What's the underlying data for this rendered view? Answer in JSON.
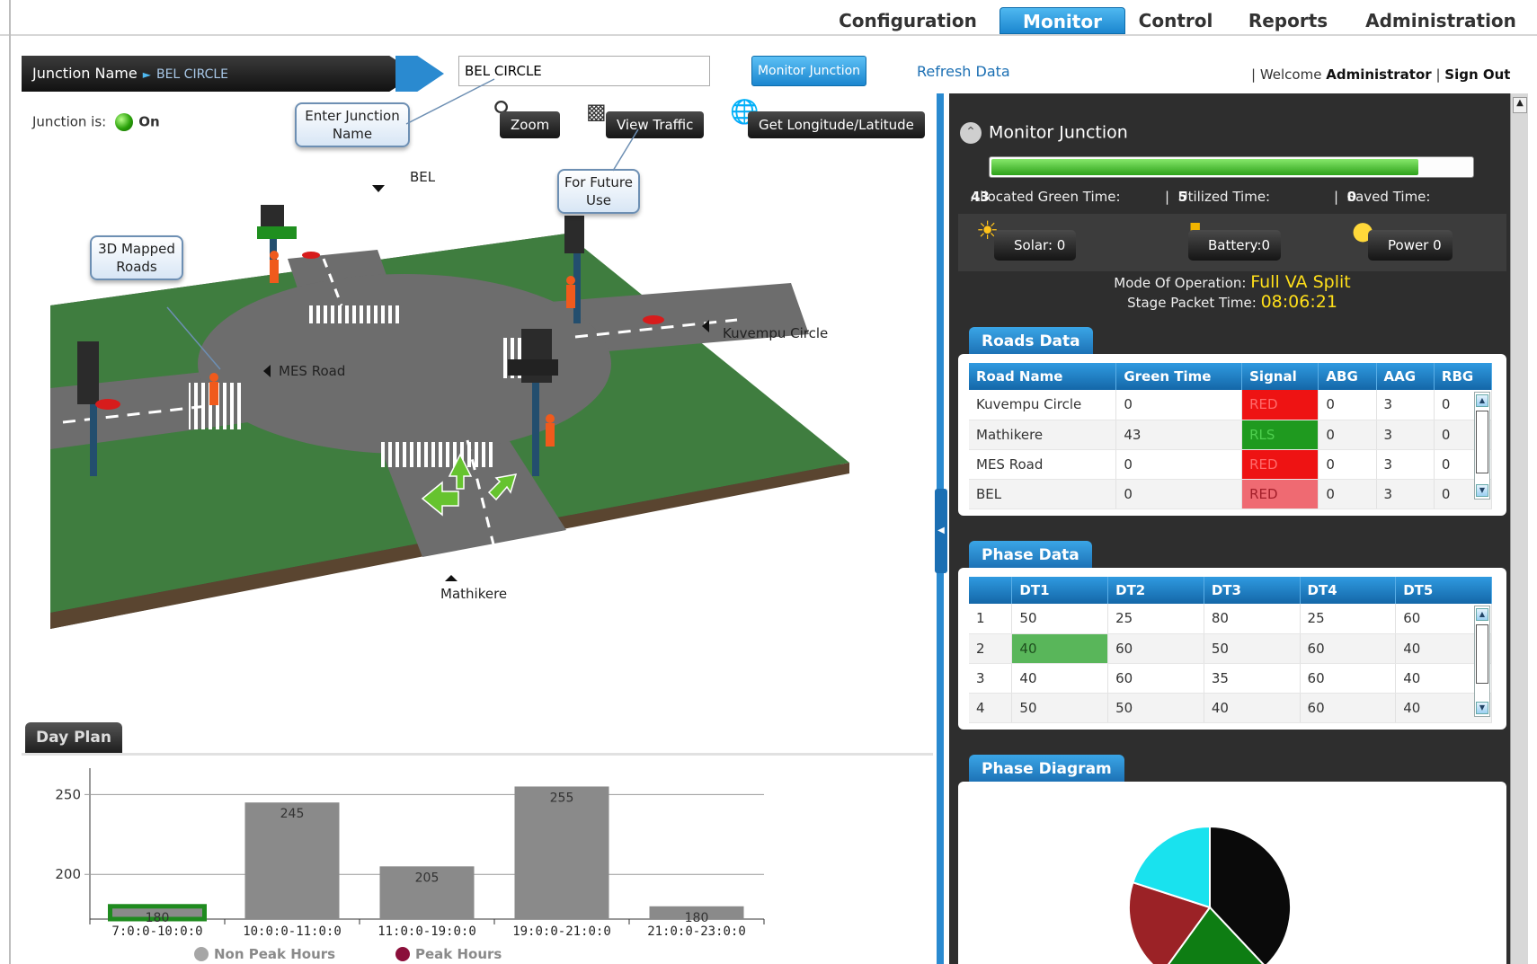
{
  "nav": {
    "items": [
      "Configuration",
      "Monitor",
      "Control",
      "Reports",
      "Administration"
    ],
    "active": "Monitor"
  },
  "toolbar": {
    "junction_label": "Junction Name",
    "junction_crumb": "BEL CIRCLE",
    "junction_input_value": "BEL CIRCLE",
    "monitor_button": "Monitor Junction",
    "refresh_link": "Refresh Data",
    "welcome_prefix": "Welcome",
    "user": "Administrator",
    "sign_out": "Sign Out"
  },
  "status": {
    "label": "Junction is:",
    "value": "On"
  },
  "tools": {
    "zoom": "Zoom",
    "view_traffic": "View Traffic",
    "get_location": "Get Longitude/Latitude"
  },
  "callouts": {
    "enter_junction": "Enter Junction Name",
    "future_use": "For Future Use",
    "mapped_roads": "3D Mapped Roads"
  },
  "roads_labels": {
    "north": "BEL",
    "east": "Kuvempu Circle",
    "west": "MES Road",
    "south": "Mathikere"
  },
  "monitor": {
    "title": "Monitor Junction",
    "progress_fraction": 0.89,
    "allocated_label": "Allocated Green Time:",
    "allocated": "43",
    "utilized_label": "Utilized Time:",
    "utilized": "5",
    "saved_label": "Saved Time:",
    "saved": "0",
    "solar": "Solar: 0",
    "battery": "Battery:0",
    "power": "Power 0",
    "mode_label": "Mode Of Operation:",
    "mode_value": "Full VA Split",
    "stage_label": "Stage Packet Time:",
    "stage_value": "08:06:21"
  },
  "roads_data": {
    "title": "Roads Data",
    "columns": [
      "Road Name",
      "Green Time",
      "Signal",
      "ABG",
      "AAG",
      "RBG"
    ],
    "rows": [
      {
        "name": "Kuvempu Circle",
        "green": "0",
        "signal": "RED",
        "abg": "0",
        "aag": "3",
        "rbg": "0",
        "state": "red"
      },
      {
        "name": "Mathikere",
        "green": "43",
        "signal": "RLS",
        "abg": "0",
        "aag": "3",
        "rbg": "0",
        "state": "green"
      },
      {
        "name": "MES Road",
        "green": "0",
        "signal": "RED",
        "abg": "0",
        "aag": "3",
        "rbg": "0",
        "state": "red"
      },
      {
        "name": "BEL",
        "green": "0",
        "signal": "RED",
        "abg": "0",
        "aag": "3",
        "rbg": "0",
        "state": "lred"
      }
    ]
  },
  "phase_data": {
    "title": "Phase Data",
    "columns": [
      "",
      "DT1",
      "DT2",
      "DT3",
      "DT4",
      "DT5"
    ],
    "rows": [
      [
        "1",
        "50",
        "25",
        "80",
        "25",
        "60"
      ],
      [
        "2",
        "40",
        "60",
        "50",
        "60",
        "40"
      ],
      [
        "3",
        "40",
        "60",
        "35",
        "60",
        "40"
      ],
      [
        "4",
        "50",
        "50",
        "40",
        "60",
        "40"
      ]
    ]
  },
  "phase_diagram": {
    "title": "Phase Diagram"
  },
  "day_plan": {
    "tab": "Day Plan"
  },
  "chart_data": {
    "type": "bar",
    "categories": [
      "7:0:0-10:0:0",
      "10:0:0-11:0:0",
      "11:0:0-19:0:0",
      "19:0:0-21:0:0",
      "21:0:0-23:0:0"
    ],
    "values": [
      180,
      245,
      205,
      255,
      180
    ],
    "data_labels": [
      "180",
      "245",
      "205",
      "255",
      "180"
    ],
    "yticks": [
      200,
      250
    ],
    "ylim": [
      172,
      262
    ],
    "legend": [
      "Non Peak Hours",
      "Peak Hours"
    ],
    "legend_placement": "bottom",
    "highlight_index": 0,
    "colors": {
      "bar": "#8a8a8a",
      "highlight": "#1f8b1f",
      "legend_non_peak": "#a6a6a6",
      "legend_peak": "#8b0f3a"
    }
  },
  "pie_data": {
    "type": "pie",
    "values": [
      38,
      22,
      20,
      20
    ],
    "colors": [
      "#0a0a0a",
      "#0e7d13",
      "#9b2226",
      "#19e2ee"
    ]
  }
}
